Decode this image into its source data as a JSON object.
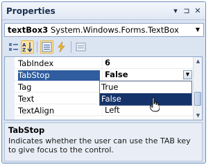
{
  "window": {
    "title": "Properties",
    "pin_glyph": "▾",
    "autohide_glyph": "⊐",
    "close_glyph": "✕"
  },
  "object_selector": {
    "name": "textBox3",
    "type": "System.Windows.Forms.TextBox"
  },
  "toolbar": {
    "buttons": [
      {
        "name": "categorized-icon",
        "active": false
      },
      {
        "name": "alphabetical-icon",
        "active": true
      },
      {
        "name": "properties-icon",
        "active": true
      },
      {
        "name": "events-lightning-icon",
        "active": false
      },
      {
        "name": "property-pages-icon",
        "active": false
      }
    ]
  },
  "grid": {
    "rows": [
      {
        "name": "TabIndex",
        "value": "6",
        "bold": true
      },
      {
        "name": "TabStop",
        "value": "False",
        "bold": true,
        "selected": true
      },
      {
        "name": "Tag",
        "value": ""
      },
      {
        "name": "Text",
        "value": ""
      },
      {
        "name": "TextAlign",
        "value": "Left"
      }
    ],
    "dropdown_options": [
      "True",
      "False"
    ],
    "highlighted_option": "False"
  },
  "description": {
    "title": "TabStop",
    "text": "Indicates whether the user can use the TAB key to give focus to the control."
  },
  "colors": {
    "selection": "#2f5d9f",
    "dropdown_highlight": "#14336a",
    "panel_bg": "#dbe4f1"
  }
}
